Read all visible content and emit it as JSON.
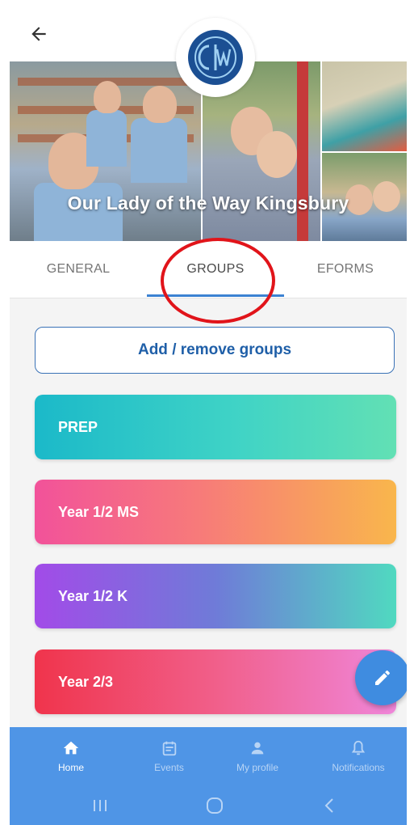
{
  "header": {
    "back_icon": "arrow-left-icon"
  },
  "school": {
    "name": "Our Lady of the Way Kingsbury",
    "logo_letters": "OLW",
    "logo_ring_text": "KINGSBURY",
    "logo_color": "#1b4f93"
  },
  "tabs": [
    {
      "label": "GENERAL",
      "active": false
    },
    {
      "label": "GROUPS",
      "active": true
    },
    {
      "label": "EFORMS",
      "active": false
    }
  ],
  "add_button": {
    "label": "Add / remove groups"
  },
  "groups": [
    {
      "label": "PREP",
      "colors": [
        "#1bb9c9",
        "#62e0b4"
      ]
    },
    {
      "label": "Year 1/2 MS",
      "colors": [
        "#f2529a",
        "#f9b64c"
      ]
    },
    {
      "label": "Year 1/2 K",
      "colors": [
        "#a24be8",
        "#50d9c0"
      ]
    },
    {
      "label": "Year 2/3",
      "colors": [
        "#f0344c",
        "#ef86d9"
      ]
    }
  ],
  "fab": {
    "icon": "pencil-icon"
  },
  "bottom_nav": [
    {
      "label": "Home",
      "icon": "home-icon",
      "active": true
    },
    {
      "label": "Events",
      "icon": "calendar-icon",
      "active": false
    },
    {
      "label": "My profile",
      "icon": "person-icon",
      "active": false
    },
    {
      "label": "Notifications",
      "icon": "bell-icon",
      "active": false
    }
  ],
  "system_nav": {
    "recents_icon": "recents-icon",
    "home_icon": "home-circle-icon",
    "back_icon": "chevron-left-icon"
  },
  "colors": {
    "accent": "#3c82d2",
    "nav_bg": "#4f95e6",
    "annotation": "#e1141a"
  }
}
